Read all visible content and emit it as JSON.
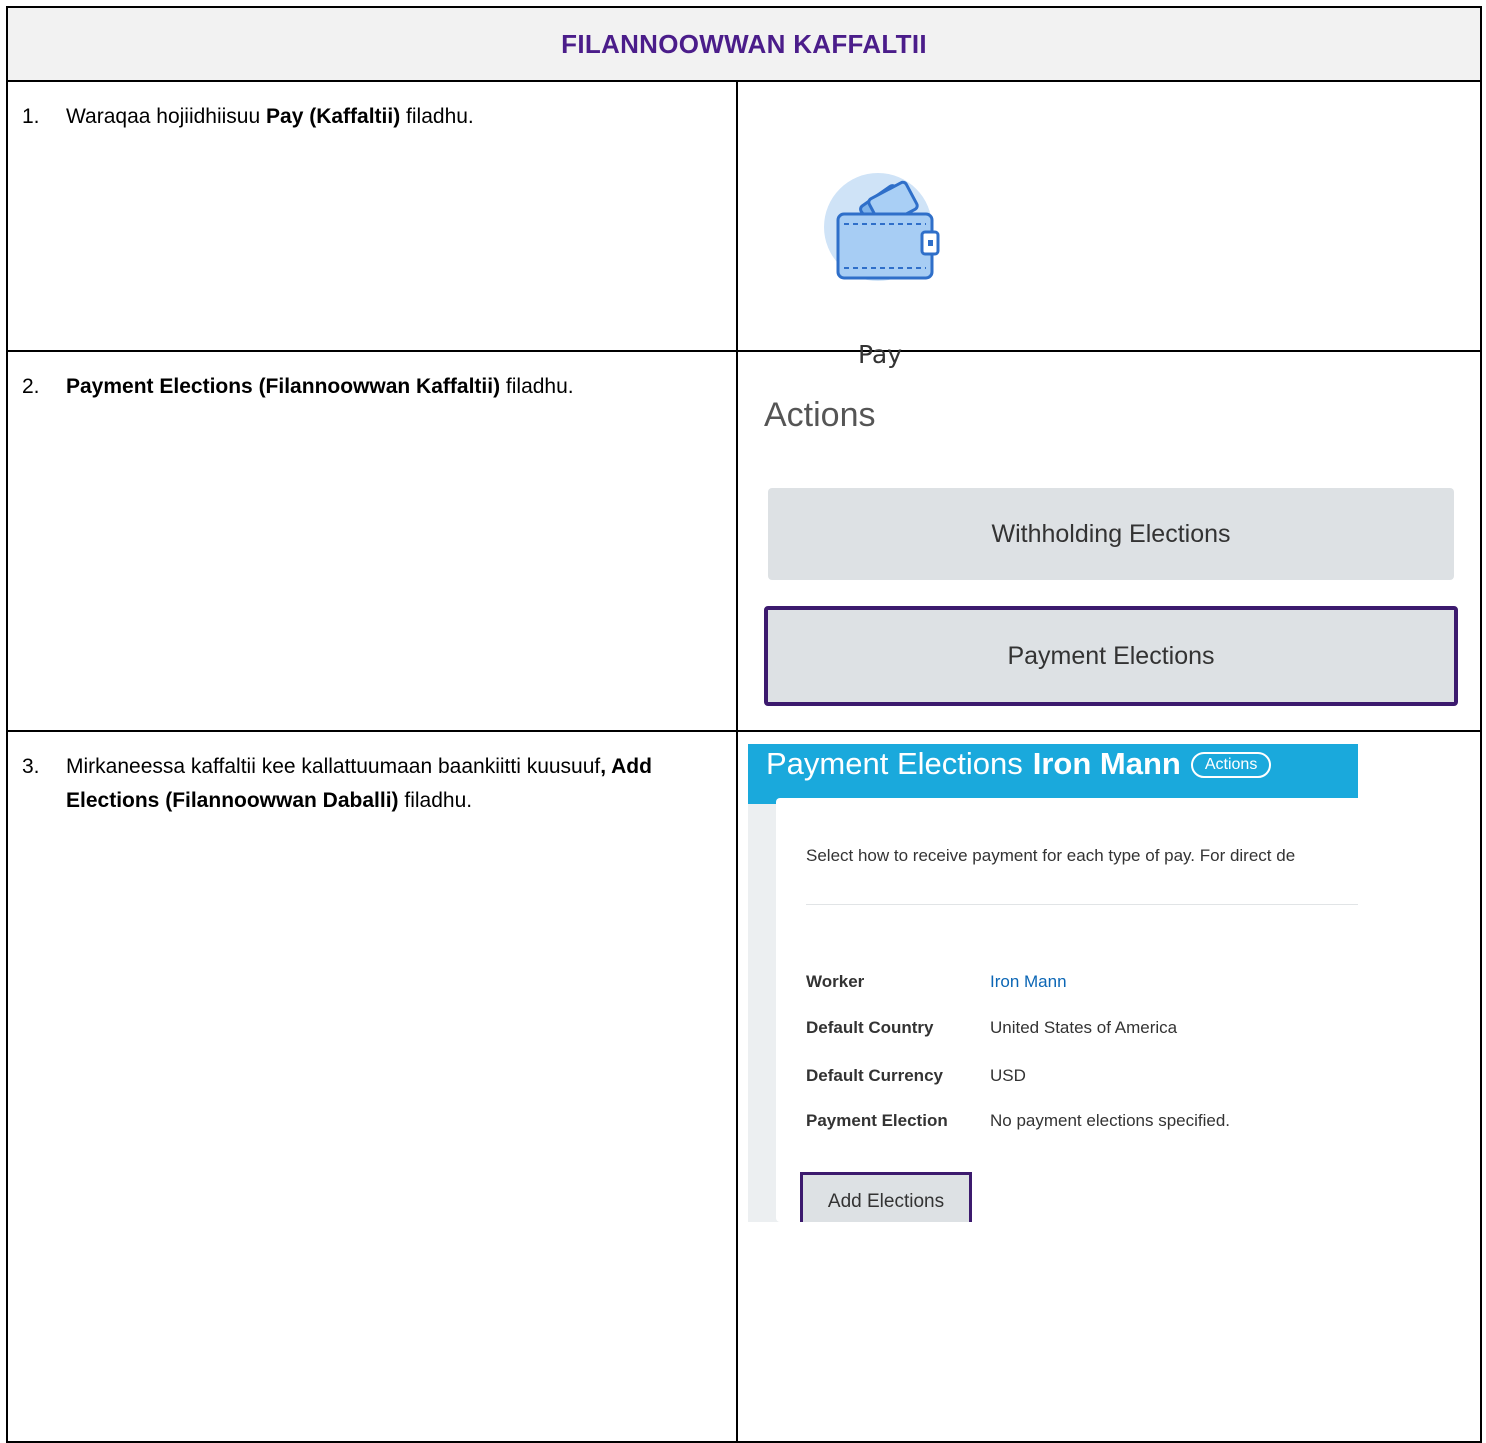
{
  "header": {
    "title": "FILANNOOWWAN KAFFALTII"
  },
  "steps": [
    {
      "number": "1.",
      "text_before": "Waraqaa hojiidhiisuu ",
      "bold": "Pay (Kaffaltii)",
      "text_after": " filadhu."
    },
    {
      "number": "2.",
      "text_before": "",
      "bold": "Payment Elections (Filannoowwan Kaffaltii)",
      "text_after": " filadhu."
    },
    {
      "number": "3.",
      "text_before": "Mirkaneessa kaffaltii kee kallattuumaan baankiitti kuusuuf",
      "bold": ", Add Elections (Filannoowwan Daballi)",
      "text_after": " filadhu."
    }
  ],
  "pay_tile": {
    "label": "Pay",
    "icon": "wallet-icon"
  },
  "actions_panel": {
    "title": "Actions",
    "buttons": [
      "Withholding Elections",
      "Payment Elections"
    ]
  },
  "payment_elections_screen": {
    "title": "Payment Elections",
    "worker_name": "Iron Mann",
    "actions_label": "Actions",
    "description": "Select how to receive payment for each type of pay. For direct de",
    "fields": [
      {
        "label": "Worker",
        "value": "Iron Mann"
      },
      {
        "label": "Default Country",
        "value": "United States of America"
      },
      {
        "label": "Default Currency",
        "value": "USD"
      },
      {
        "label": "Payment Election",
        "value": "No payment elections specified."
      }
    ],
    "add_button": "Add Elections"
  },
  "colors": {
    "title_purple": "#4b1d8a",
    "highlight_border": "#3c1a6e",
    "workday_blue": "#1aa9dc"
  }
}
